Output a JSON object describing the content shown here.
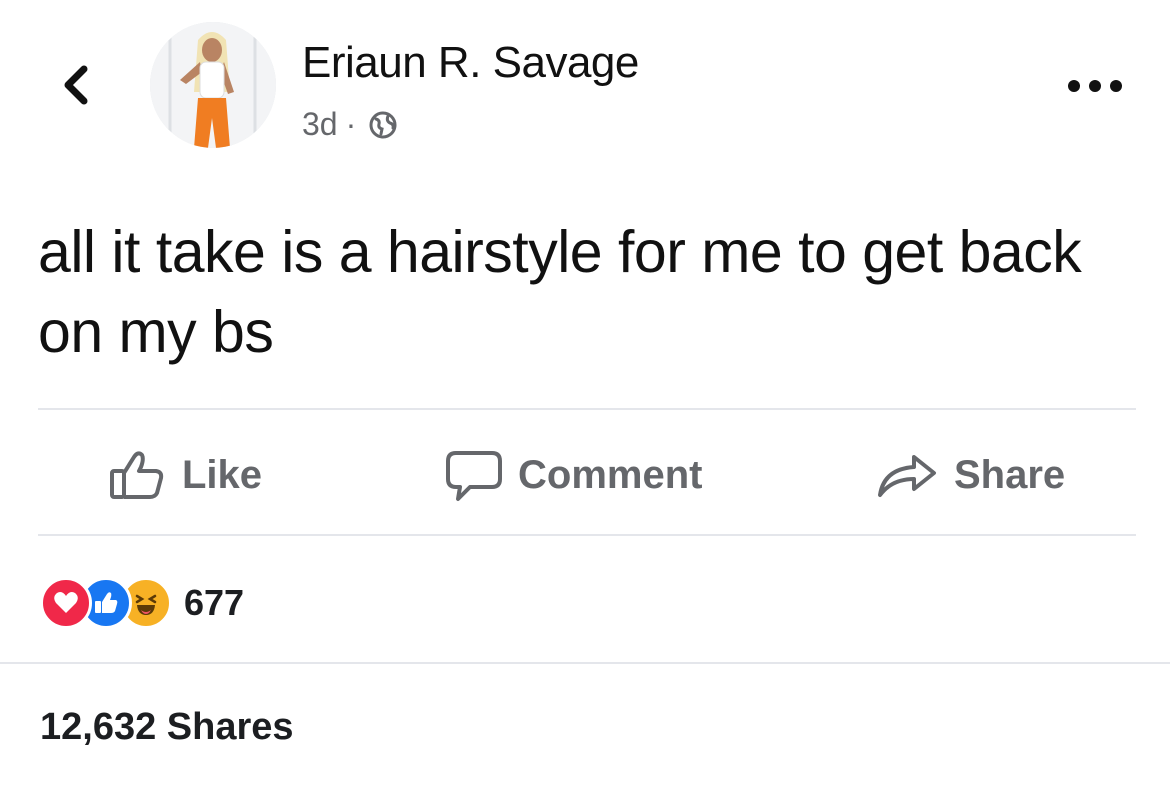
{
  "header": {
    "author_name": "Eriaun R. Savage",
    "time_ago": "3d",
    "separator": "·",
    "back_icon": "chevron-left-icon",
    "more_icon": "ellipsis-icon",
    "audience_icon": "globe-icon"
  },
  "post": {
    "text": "all it take is a hairstyle for me to get back on my bs"
  },
  "actions": {
    "like_label": "Like",
    "comment_label": "Comment",
    "share_label": "Share"
  },
  "reactions": {
    "types": [
      "love",
      "like",
      "haha"
    ],
    "count": "677"
  },
  "shares": {
    "label": "12,632 Shares"
  },
  "colors": {
    "love": "#f02849",
    "like": "#1877f2",
    "haha": "#f7b125",
    "muted_text": "#65676b",
    "divider": "#e4e6eb"
  }
}
